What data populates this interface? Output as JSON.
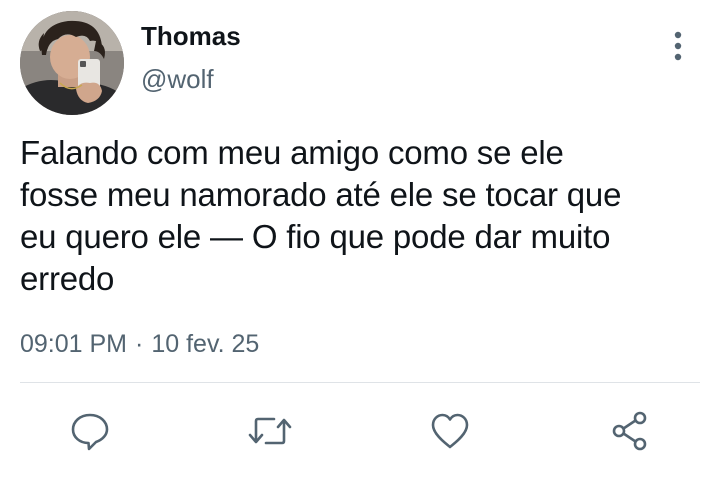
{
  "author": {
    "display_name": "Thomas",
    "handle": "@wolf",
    "avatar_icon": "profile-photo"
  },
  "tweet": {
    "text": "Falando com meu amigo como se ele\nfosse meu namorado até ele se tocar que\neu quero ele — O fio que pode dar muito\nerredo",
    "time": "09:01 PM",
    "separator": "·",
    "date": "10 fev. 25"
  },
  "actions": {
    "reply_icon": "speech-bubble-icon",
    "retweet_icon": "retweet-icon",
    "like_icon": "heart-icon",
    "share_icon": "share-icon"
  },
  "colors": {
    "text": "#0f1419",
    "secondary": "#536471",
    "icon": "#536471",
    "divider": "#dfe3e7"
  }
}
